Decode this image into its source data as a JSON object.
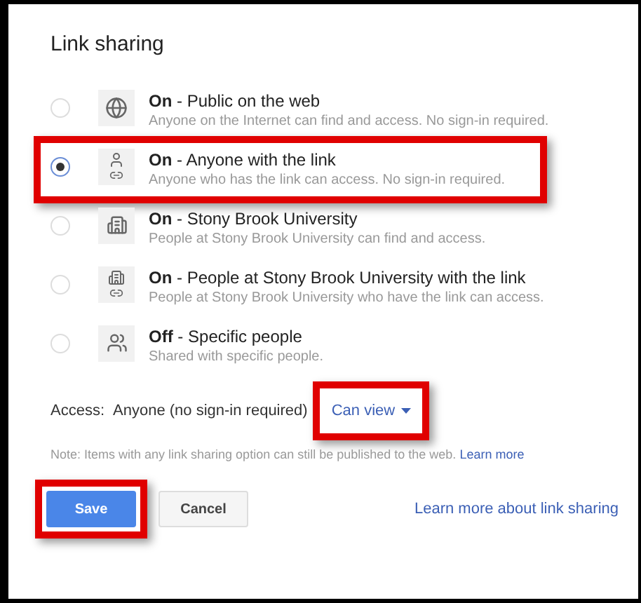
{
  "title": "Link sharing",
  "separator": "-",
  "options": [
    {
      "status": "On",
      "label": "Public on the web",
      "description": "Anyone on the Internet can find and access. No sign-in required.",
      "kind": "globe",
      "selected": false,
      "highlighted": false
    },
    {
      "status": "On",
      "label": "Anyone with the link",
      "description": "Anyone who has the link can access. No sign-in required.",
      "kind": "person-link",
      "selected": true,
      "highlighted": true
    },
    {
      "status": "On",
      "label": "Stony Brook University",
      "description": "People at Stony Brook University can find and access.",
      "kind": "building",
      "selected": false,
      "highlighted": false
    },
    {
      "status": "On",
      "label": "People at Stony Brook University with the link",
      "description": "People at Stony Brook University who have the link can access.",
      "kind": "building-link",
      "selected": false,
      "highlighted": false
    },
    {
      "status": "Off",
      "label": "Specific people",
      "description": "Shared with specific people.",
      "kind": "people",
      "selected": false,
      "highlighted": false
    }
  ],
  "access": {
    "label": "Access:",
    "value": "Anyone (no sign-in required)",
    "dropdown": "Can view",
    "highlighted": true
  },
  "note": {
    "text": "Note: Items with any link sharing option can still be published to the web.",
    "link": "Learn more"
  },
  "buttons": [
    {
      "label": "Save",
      "kind": "primary",
      "highlighted": true
    },
    {
      "label": "Cancel",
      "kind": "secondary",
      "highlighted": false
    }
  ],
  "help_link": "Learn more about link sharing"
}
